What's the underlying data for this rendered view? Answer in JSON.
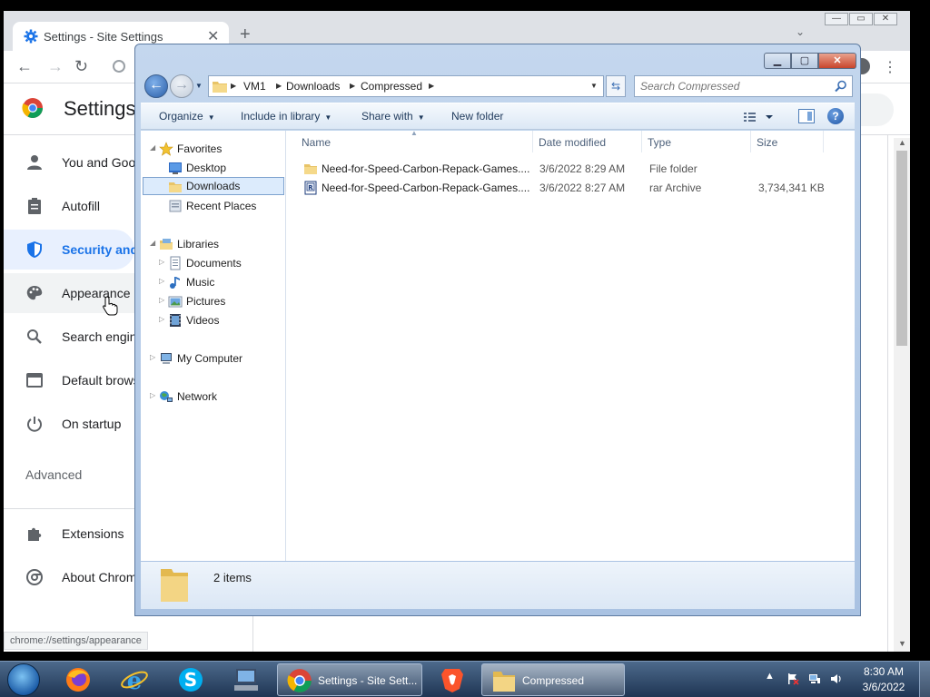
{
  "chrome": {
    "tab_title": "Settings - Site Settings",
    "tab_close": "✕",
    "new_tab": "+",
    "tab_search": "⌄",
    "win_min": "—",
    "win_max": "▭",
    "win_close": "✕",
    "back": "←",
    "forward": "→",
    "reload": "↻",
    "menu": "⋮",
    "settings_title": "Settings",
    "nav": [
      {
        "label": "You and Google",
        "icon": "person-icon"
      },
      {
        "label": "Autofill",
        "icon": "clipboard-icon"
      },
      {
        "label": "Security and Privacy",
        "icon": "shield-icon"
      },
      {
        "label": "Appearance",
        "icon": "palette-icon"
      },
      {
        "label": "Search engine",
        "icon": "search-icon"
      },
      {
        "label": "Default browser",
        "icon": "browser-icon"
      },
      {
        "label": "On startup",
        "icon": "power-icon"
      }
    ],
    "advanced": "Advanced",
    "nav2": [
      {
        "label": "Extensions",
        "icon": "puzzle-icon"
      },
      {
        "label": "About Chrome",
        "icon": "chrome-icon"
      }
    ],
    "status_url": "chrome://settings/appearance",
    "scroll_up": "▲",
    "scroll_down": "▼"
  },
  "explorer": {
    "cap_min": "▁",
    "cap_max": "▢",
    "cap_close": "✕",
    "back": "←",
    "forward": "→",
    "breadcrumb": [
      "VM1",
      "Downloads",
      "Compressed"
    ],
    "refresh": "⇆",
    "search_placeholder": "Search Compressed",
    "commands": {
      "organize": "Organize",
      "include": "Include in library",
      "share": "Share with",
      "new_folder": "New folder"
    },
    "help": "?",
    "nav": {
      "favorites": "Favorites",
      "desktop": "Desktop",
      "downloads": "Downloads",
      "recent": "Recent Places",
      "libraries": "Libraries",
      "documents": "Documents",
      "music": "Music",
      "pictures": "Pictures",
      "videos": "Videos",
      "computer": "My Computer",
      "network": "Network"
    },
    "columns": [
      "Name",
      "Date modified",
      "Type",
      "Size"
    ],
    "files": [
      {
        "name": "Need-for-Speed-Carbon-Repack-Games....",
        "date": "3/6/2022 8:29 AM",
        "type": "File folder",
        "size": ""
      },
      {
        "name": "Need-for-Speed-Carbon-Repack-Games....",
        "date": "3/6/2022 8:27 AM",
        "type": "rar Archive",
        "size": "3,734,341 KB"
      }
    ],
    "item_count": "2 items"
  },
  "taskbar": {
    "chrome_task": "Settings - Site Sett...",
    "explorer_task": "Compressed",
    "tray_arrow": "▲",
    "time": "8:30 AM",
    "date": "3/6/2022"
  },
  "colors": {
    "chrome_accent": "#1a73e8",
    "explorer_frame": "#a9c2e2",
    "taskbar": "#2a4566",
    "folder_yellow": "#e8c468"
  }
}
